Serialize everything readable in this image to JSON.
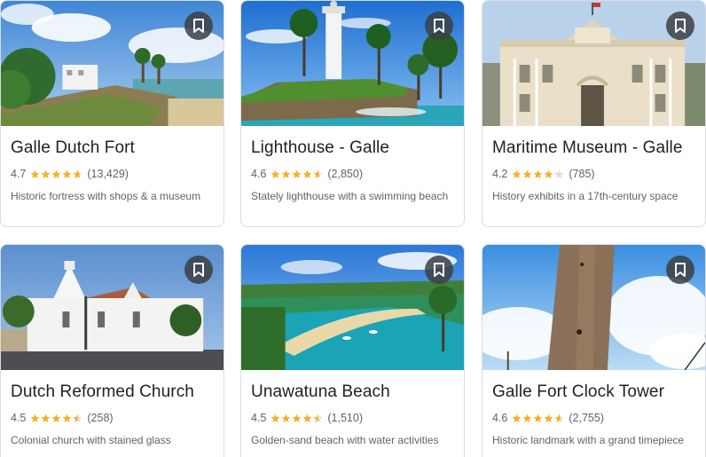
{
  "colors": {
    "star": "#f6b026",
    "star_empty": "#dadce0",
    "save_bg": "#3c4043"
  },
  "places": [
    {
      "title": "Galle Dutch Fort",
      "rating": "4.7",
      "rating_value": 4.7,
      "reviews": "(13,429)",
      "description": "Historic fortress with shops & a museum",
      "image_icon": "fort-landscape-image",
      "save_icon": "bookmark-icon"
    },
    {
      "title": "Lighthouse - Galle",
      "rating": "4.6",
      "rating_value": 4.6,
      "reviews": "(2,850)",
      "description": "Stately lighthouse with a swimming beach",
      "image_icon": "lighthouse-image",
      "save_icon": "bookmark-icon"
    },
    {
      "title": "Maritime Museum - Galle",
      "rating": "4.2",
      "rating_value": 4.2,
      "reviews": "(785)",
      "description": "History exhibits in a 17th-century space",
      "image_icon": "museum-building-image",
      "save_icon": "bookmark-icon"
    },
    {
      "title": "Dutch Reformed Church",
      "rating": "4.5",
      "rating_value": 4.5,
      "reviews": "(258)",
      "description": "Colonial church with stained glass",
      "image_icon": "church-image",
      "save_icon": "bookmark-icon"
    },
    {
      "title": "Unawatuna Beach",
      "rating": "4.5",
      "rating_value": 4.5,
      "reviews": "(1,510)",
      "description": "Golden-sand beach with water activities",
      "image_icon": "beach-bay-image",
      "save_icon": "bookmark-icon"
    },
    {
      "title": "Galle Fort Clock Tower",
      "rating": "4.6",
      "rating_value": 4.6,
      "reviews": "(2,755)",
      "description": "Historic landmark with a grand timepiece",
      "image_icon": "clock-tower-image",
      "save_icon": "bookmark-icon"
    }
  ]
}
